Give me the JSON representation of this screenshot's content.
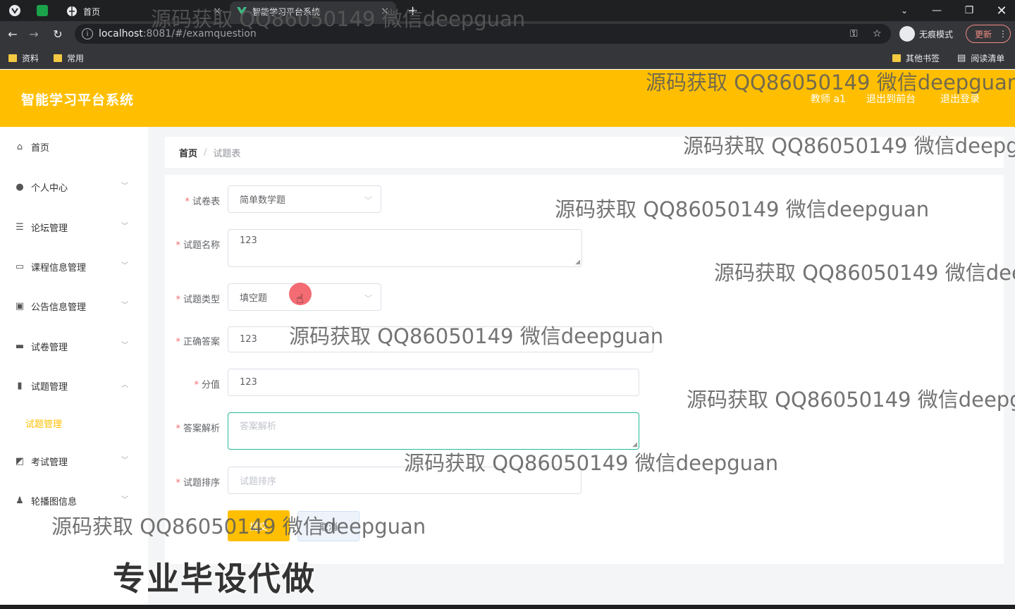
{
  "browser": {
    "tabs": [
      {
        "title": "首页"
      },
      {
        "title": "智能学习平台系统"
      }
    ],
    "new_tab": "+",
    "url_host": "localhost",
    "url_path": ":8081/#/examquestion",
    "incognito_label": "无痕模式",
    "update_label": "更新",
    "bookmarks": [
      "资料",
      "常用"
    ],
    "bookmarks_right": [
      "其他书签",
      "阅读清单"
    ]
  },
  "header": {
    "title": "智能学习平台系统",
    "user": "教师 a1",
    "to_front": "退出到前台",
    "logout": "退出登录"
  },
  "sidebar": {
    "items": [
      {
        "label": "首页",
        "icon": "home-icon"
      },
      {
        "label": "个人中心",
        "icon": "user-icon"
      },
      {
        "label": "论坛管理",
        "icon": "sliders-icon"
      },
      {
        "label": "课程信息管理",
        "icon": "card-icon"
      },
      {
        "label": "公告信息管理",
        "icon": "clipboard-icon"
      },
      {
        "label": "试卷管理",
        "icon": "laptop-icon"
      },
      {
        "label": "试题管理",
        "icon": "bar-chart-icon"
      },
      {
        "label": "考试管理",
        "icon": "line-chart-icon"
      },
      {
        "label": "轮播图信息",
        "icon": "person-icon"
      }
    ],
    "active_sub": "试题管理"
  },
  "breadcrumb": {
    "home": "首页",
    "sep": "/",
    "current": "试题表"
  },
  "form": {
    "paper_label": "试卷表",
    "paper_value": "简单数学题",
    "name_label": "试题名称",
    "name_value": "123",
    "type_label": "试题类型",
    "type_value": "填空题",
    "answer_label": "正确答案",
    "answer_value": "123",
    "score_label": "分值",
    "score_value": "123",
    "analysis_label": "答案解析",
    "analysis_placeholder": "答案解析",
    "order_label": "试题排序",
    "order_placeholder": "试题排序",
    "submit": "提交",
    "cancel": "取消"
  },
  "watermark_text": "源码获取 QQ86050149 微信deepguan",
  "banner_text": "专业毕设代做"
}
